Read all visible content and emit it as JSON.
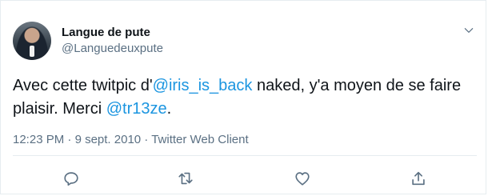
{
  "author": {
    "name": "Langue de pute",
    "handle": "@Languedeuxpute"
  },
  "tweet": {
    "text_part1": "Avec cette twitpic d'",
    "mention1": "@iris_is_back",
    "text_part2": " naked, y'a moyen de se faire plaisir. Merci ",
    "mention2": "@tr13ze",
    "text_part3": "."
  },
  "meta": {
    "time": "12:23 PM",
    "separator1": " · ",
    "date": "9 sept. 2010",
    "separator2": " · ",
    "client": "Twitter Web Client"
  },
  "icons": {
    "menu": "chevron-down-icon",
    "reply": "reply-icon",
    "retweet": "retweet-icon",
    "like": "heart-icon",
    "share": "share-icon"
  },
  "colors": {
    "link": "#1b95e0",
    "secondary_text": "#5b7083",
    "divider": "#e6ecf0"
  }
}
